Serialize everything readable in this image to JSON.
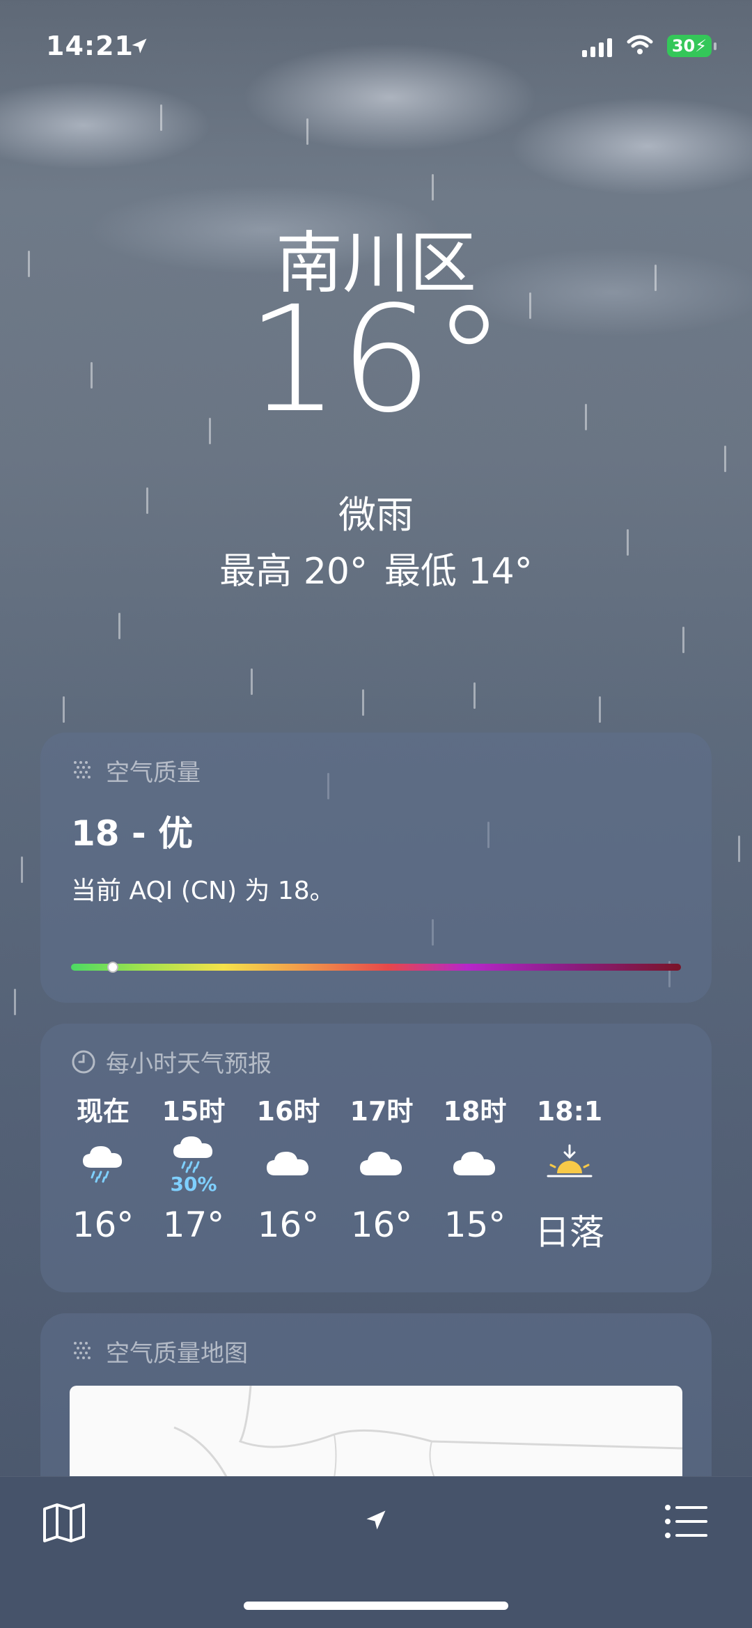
{
  "status_bar": {
    "time": "14:21",
    "battery": "30"
  },
  "hero": {
    "city": "南川区",
    "temperature": "16°",
    "condition": "微雨",
    "high": "最高 20°",
    "low": "最低 14°"
  },
  "air_quality": {
    "title": "空气质量",
    "value": "18 - 优",
    "description": "当前 AQI (CN) 为 18。",
    "level_fraction": 0.027
  },
  "hourly": {
    "title": "每小时天气预报",
    "items": [
      {
        "label": "现在",
        "icon": "rain-cloud-icon",
        "precip": "",
        "temp": "16°"
      },
      {
        "label": "15时",
        "icon": "rain-cloud-icon",
        "precip": "30%",
        "temp": "17°"
      },
      {
        "label": "16时",
        "icon": "cloud-icon",
        "precip": "",
        "temp": "16°"
      },
      {
        "label": "17时",
        "icon": "cloud-icon",
        "precip": "",
        "temp": "16°"
      },
      {
        "label": "18时",
        "icon": "cloud-icon",
        "precip": "",
        "temp": "15°"
      },
      {
        "label": "18:1",
        "icon": "sunset-icon",
        "precip": "",
        "temp": "日落"
      }
    ]
  },
  "air_map": {
    "title": "空气质量地图"
  },
  "colors": {
    "precip": "#7fd0ff",
    "battery": "#34c759"
  }
}
